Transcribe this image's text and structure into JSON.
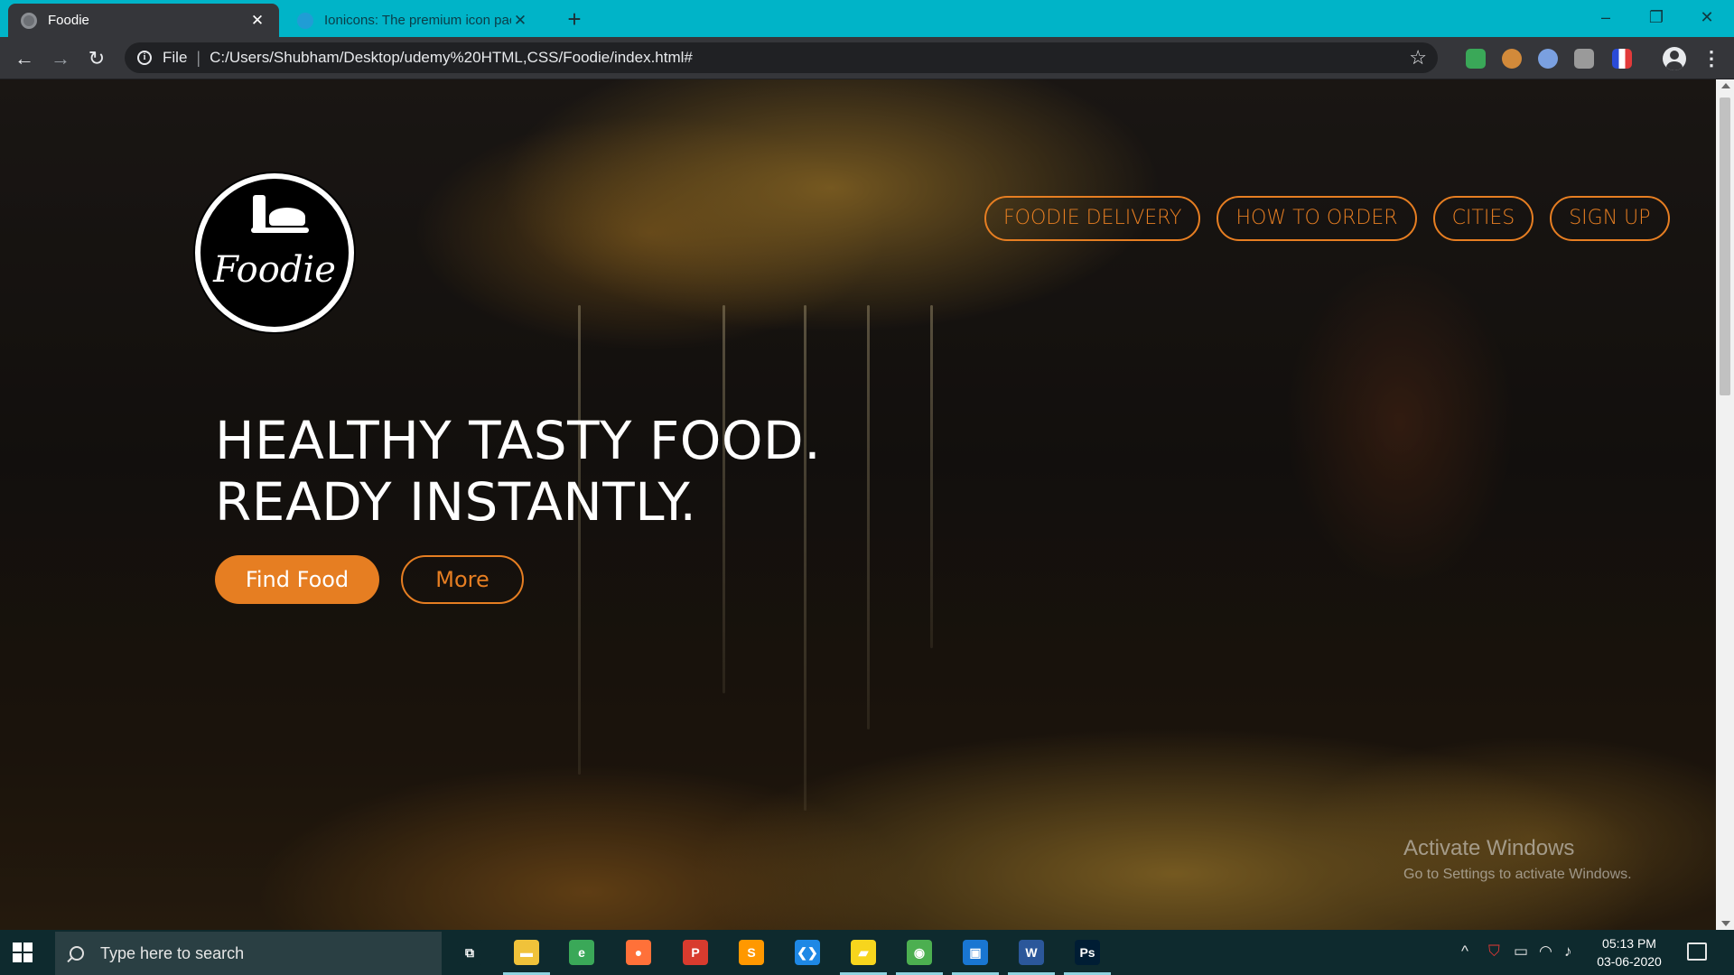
{
  "browser": {
    "tabs": [
      {
        "title": "Foodie",
        "active": true
      },
      {
        "title": "Ionicons: The premium icon pack",
        "active": false
      }
    ],
    "new_tab_label": "+",
    "window_controls": {
      "minimize": "–",
      "restore": "❐",
      "close": "✕"
    },
    "toolbar": {
      "back_glyph": "←",
      "forward_glyph": "→",
      "reload_glyph": "↻",
      "scheme": "File",
      "separator": "|",
      "url": "C:/Users/Shubham/Desktop/udemy%20HTML,CSS/Foodie/index.html#",
      "bookmark_glyph": "☆",
      "menu_glyph": "⋮"
    },
    "accent_color": "#00b4c8"
  },
  "page": {
    "logo_text": "Foodie",
    "nav": [
      "FOODIE DELIVERY",
      "HOW TO ORDER",
      "CITIES",
      "SIGN UP"
    ],
    "hero": {
      "line1": "HEALTHY TASTY FOOD.",
      "line2": "READY INSTANTLY.",
      "primary_button": "Find Food",
      "secondary_button": "More"
    },
    "accent_color": "#e67e22"
  },
  "watermark": {
    "title": "Activate Windows",
    "subtitle": "Go to Settings to activate Windows."
  },
  "taskbar": {
    "search_placeholder": "Type here to search",
    "apps": [
      {
        "name": "task-view",
        "label": "⧉",
        "color": "#0e2a2e"
      },
      {
        "name": "file-explorer",
        "label": "▬",
        "color": "#f0c23a"
      },
      {
        "name": "edge-beta",
        "label": "e",
        "color": "#3aa858"
      },
      {
        "name": "firefox",
        "label": "●",
        "color": "#ff7139"
      },
      {
        "name": "app-p",
        "label": "P",
        "color": "#d83b2e"
      },
      {
        "name": "sublime-text",
        "label": "S",
        "color": "#ff9800"
      },
      {
        "name": "vs-code",
        "label": "❮❯",
        "color": "#1e88e5"
      },
      {
        "name": "sticky-notes",
        "label": "▰",
        "color": "#f7d51d"
      },
      {
        "name": "chrome",
        "label": "◉",
        "color": "#4caf50"
      },
      {
        "name": "app-box",
        "label": "▣",
        "color": "#1976d2"
      },
      {
        "name": "word",
        "label": "W",
        "color": "#2b579a"
      },
      {
        "name": "photoshop",
        "label": "Ps",
        "color": "#001d34"
      }
    ],
    "tray": {
      "chevron": "^",
      "time": "05:13 PM",
      "date": "03-06-2020"
    }
  }
}
